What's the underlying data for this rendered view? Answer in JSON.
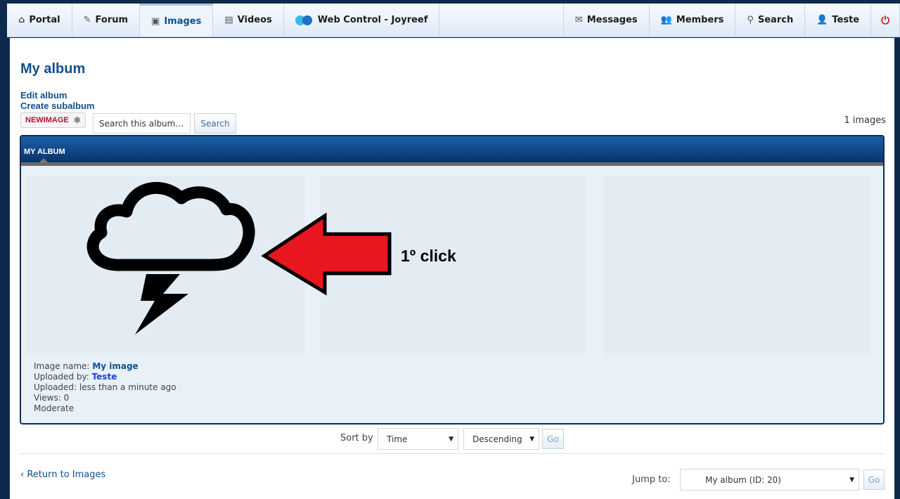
{
  "nav": {
    "items": [
      {
        "label": "Portal",
        "icon": "home-icon",
        "glyph": "⌂"
      },
      {
        "label": "Forum",
        "icon": "pencil-icon",
        "glyph": "✎"
      },
      {
        "label": "Images",
        "icon": "images-icon",
        "glyph": "▣"
      },
      {
        "label": "Videos",
        "icon": "film-icon",
        "glyph": "▤"
      },
      {
        "label": "Web Control - Joyreef",
        "icon": "web-control-icon"
      }
    ],
    "right_items": [
      {
        "label": "Messages",
        "icon": "envelope-icon",
        "glyph": "✉"
      },
      {
        "label": "Members",
        "icon": "members-icon",
        "glyph": "👥"
      },
      {
        "label": "Search",
        "icon": "magnifier-icon",
        "glyph": "⚲"
      },
      {
        "label": "Teste",
        "icon": "user-icon",
        "glyph": "👤"
      }
    ],
    "power_glyph": "⏻",
    "active": "Images"
  },
  "page": {
    "title": "My album",
    "actions": {
      "edit": "Edit album",
      "create": "Create subalbum"
    },
    "tag": {
      "label": "NEWIMAGE",
      "star": "✱"
    },
    "search": {
      "placeholder": "Search this album…",
      "button": "Search"
    },
    "count": "1 images"
  },
  "album": {
    "header": "MY ALBUM",
    "image": {
      "name_label": "Image name:",
      "name": "My image",
      "uploader_label": "Uploaded by:",
      "uploader": "Teste",
      "uploaded": "Uploaded: less than a minute ago",
      "views": "Views: 0",
      "moderate": "Moderate"
    },
    "annotation": "1º click"
  },
  "sort": {
    "label": "Sort by",
    "field": "Time",
    "order": "Descending",
    "go": "Go"
  },
  "footer": {
    "return": "‹ Return to Images",
    "jump_label": "Jump to:",
    "jump_value": "My album (ID: 20)",
    "go": "Go"
  },
  "colors": {
    "accent": "#10508a",
    "arrow": "#e8161f",
    "panel_border": "#0f2f52"
  }
}
